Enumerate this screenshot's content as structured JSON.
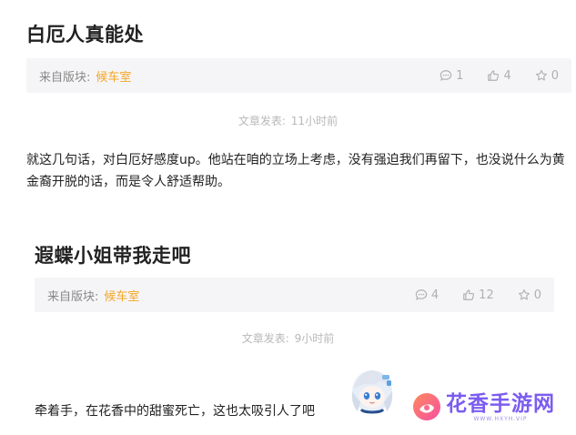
{
  "posts": [
    {
      "title": "白厄人真能处",
      "source_label": "来自版块:",
      "source_name": "候车室",
      "comments": "1",
      "likes": "4",
      "favorites": "0",
      "time_label": "文章发表:",
      "time_value": "11小时前",
      "content": "就这几句话，对白厄好感度up。他站在咱的立场上考虑，没有强迫我们再留下，也没说什么为黄金裔开脱的话，而是令人舒适帮助。"
    },
    {
      "title": "遐蝶小姐带我走吧",
      "source_label": "来自版块:",
      "source_name": "候车室",
      "comments": "4",
      "likes": "12",
      "favorites": "0",
      "time_label": "文章发表:",
      "time_value": "9小时前",
      "content": "牵着手，在花香中的甜蜜死亡，这也太吸引人了吧"
    }
  ],
  "watermark": {
    "title": "花香手游网",
    "subtitle": "WWW.HXYH.VIP"
  },
  "colors": {
    "accent": "#f5a623",
    "meta_bg": "#f5f5f7",
    "watermark": "#7b5cf0"
  },
  "icons": [
    "comment-icon",
    "thumbs-up-icon",
    "star-icon"
  ]
}
